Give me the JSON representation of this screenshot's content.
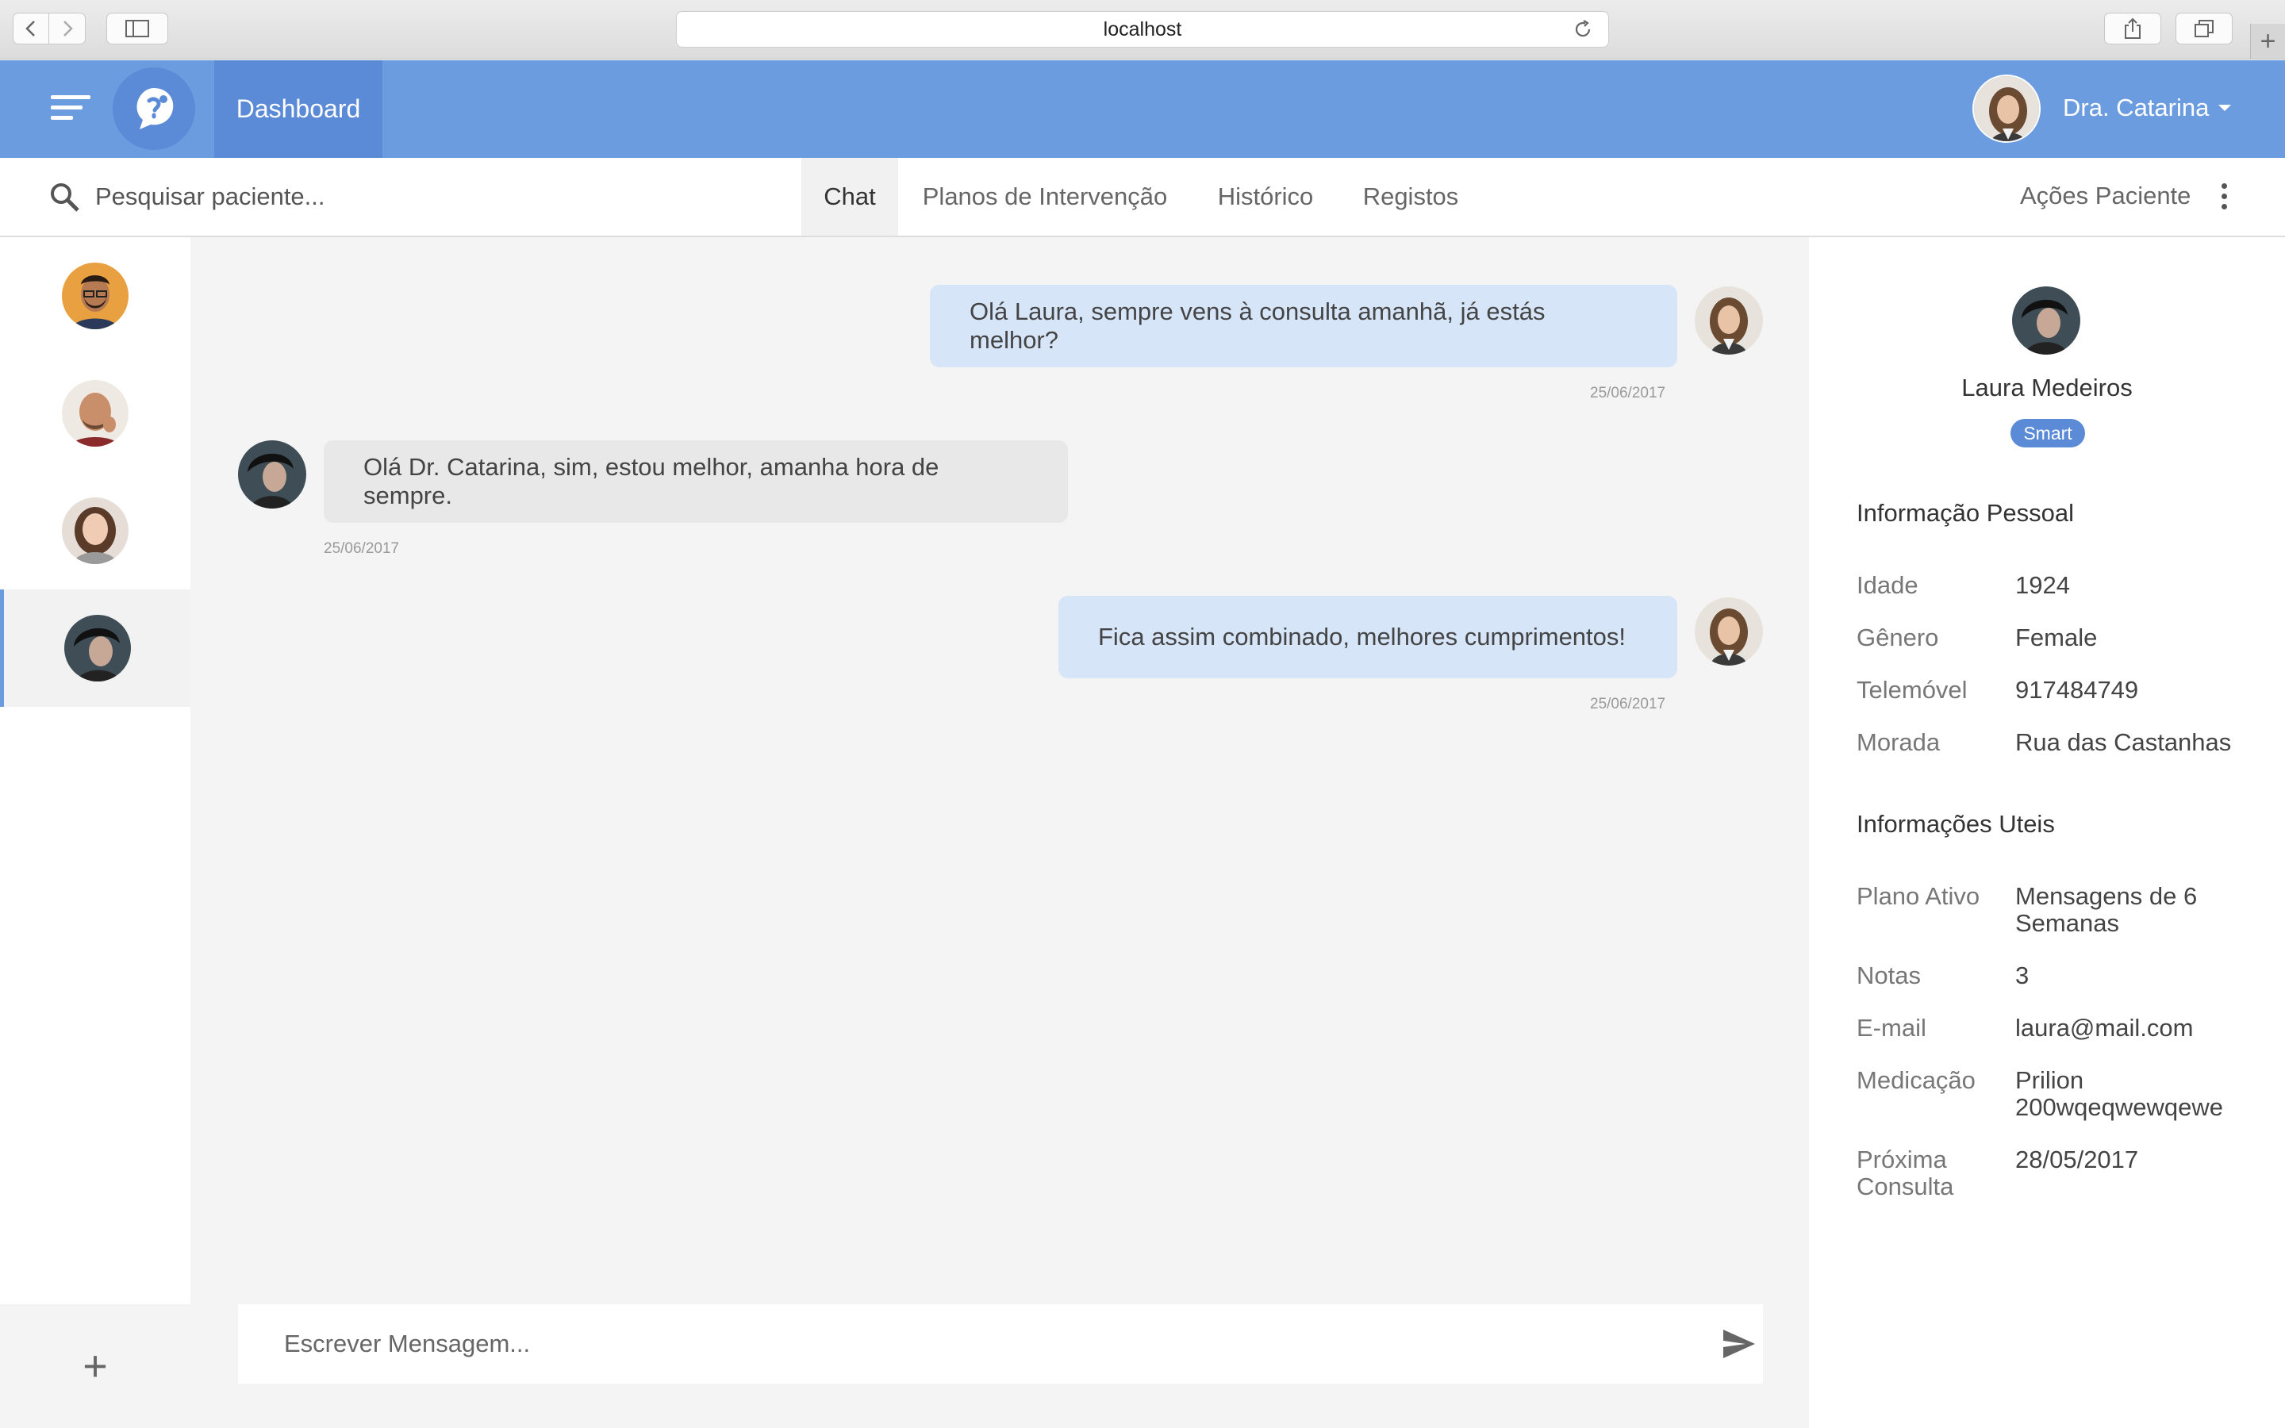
{
  "browser": {
    "url": "localhost"
  },
  "header": {
    "dashboard_label": "Dashboard",
    "user_name": "Dra. Catarina"
  },
  "toolbar": {
    "search_placeholder": "Pesquisar paciente...",
    "tabs": [
      "Chat",
      "Planos de Intervenção",
      "Histórico",
      "Registos"
    ],
    "patient_actions": "Ações Paciente"
  },
  "chat": {
    "messages": [
      {
        "direction": "out",
        "text": "Olá Laura, sempre vens à consulta amanhã, já estás melhor?",
        "date": "25/06/2017"
      },
      {
        "direction": "in",
        "text": "Olá Dr. Catarina, sim, estou melhor, amanha hora de sempre.",
        "date": "25/06/2017"
      },
      {
        "direction": "out",
        "text": "Fica assim combinado, melhores cumprimentos!",
        "date": "25/06/2017"
      }
    ],
    "composer_placeholder": "Escrever Mensagem..."
  },
  "profile": {
    "name": "Laura Medeiros",
    "badge": "Smart",
    "personal_title": "Informação Pessoal",
    "personal": [
      {
        "label": "Idade",
        "value": "1924"
      },
      {
        "label": "Gênero",
        "value": "Female"
      },
      {
        "label": "Telemóvel",
        "value": "917484749"
      },
      {
        "label": "Morada",
        "value": "Rua das Castanhas"
      }
    ],
    "useful_title": "Informações Uteis",
    "useful": [
      {
        "label": "Plano Ativo",
        "value": "Mensagens de 6 Semanas"
      },
      {
        "label": "Notas",
        "value": "3"
      },
      {
        "label": "E-mail",
        "value": "laura@mail.com"
      },
      {
        "label": "Medicação",
        "value": "Prilion 200wqeqwewqewe"
      },
      {
        "label": "Próxima Consulta",
        "value": "28/05/2017"
      }
    ]
  },
  "colors": {
    "accent": "#6c9ce0",
    "accent_dark": "#5b8ad6",
    "bubble_out": "#d7e5f9",
    "bubble_in": "#e8e8e8"
  }
}
